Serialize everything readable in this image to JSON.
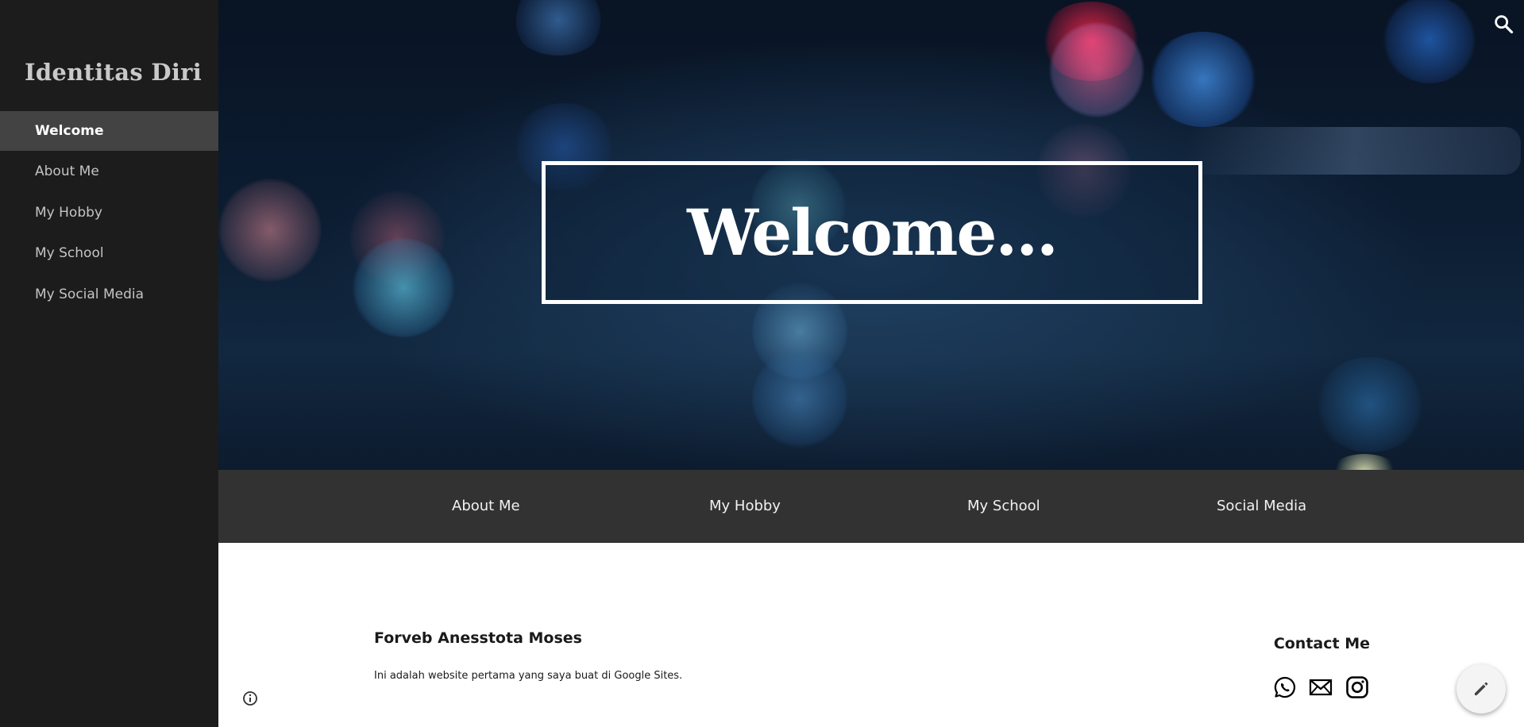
{
  "sidebar": {
    "site_title": "Identitas Diri",
    "items": [
      {
        "label": "Welcome",
        "active": true
      },
      {
        "label": "About Me",
        "active": false
      },
      {
        "label": "My Hobby",
        "active": false
      },
      {
        "label": "My School",
        "active": false
      },
      {
        "label": "My Social Media",
        "active": false
      }
    ]
  },
  "hero": {
    "heading": "Welcome..."
  },
  "tabs": [
    {
      "label": "About Me"
    },
    {
      "label": "My Hobby"
    },
    {
      "label": "My School"
    },
    {
      "label": "Social Media"
    }
  ],
  "footer": {
    "name": "Forveb Anesstota Moses",
    "description": "Ini adalah website pertama yang saya buat di Google Sites.",
    "contact_title": "Contact Me",
    "social_icons": [
      "whatsapp-icon",
      "mail-icon",
      "instagram-icon"
    ]
  },
  "icons": {
    "search": "search-icon",
    "info": "info-icon",
    "edit": "pencil-icon"
  },
  "colors": {
    "sidebar_bg": "#1c1c1c",
    "active_item_bg": "#434343",
    "tabbar_bg": "#323232",
    "hero_bg": "#0b1c31"
  }
}
